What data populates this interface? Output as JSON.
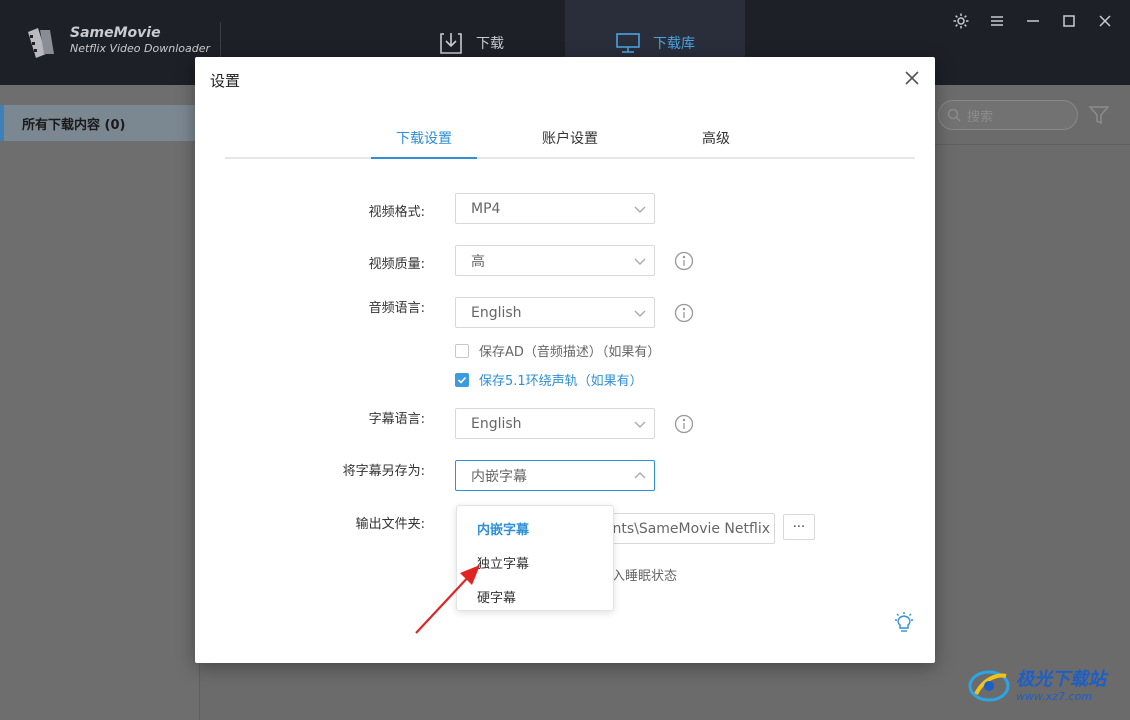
{
  "app": {
    "name": "SameMovie",
    "subtitle": "Netflix Video Downloader",
    "nav": {
      "download": "下载",
      "library": "下载库"
    }
  },
  "sidebar": {
    "all_downloads": "所有下载内容 (0)"
  },
  "search": {
    "placeholder": "搜索"
  },
  "dialog": {
    "title": "设置",
    "tabs": [
      "下载设置",
      "账户设置",
      "高级"
    ],
    "video_format": {
      "label": "视频格式:",
      "value": "MP4"
    },
    "video_quality": {
      "label": "视频质量:",
      "value": "高"
    },
    "audio_language": {
      "label": "音频语言:",
      "value": "English"
    },
    "save_ad": {
      "label": "保存AD（音频描述）（如果有）",
      "checked": false
    },
    "save_51": {
      "label": "保存5.1环绕声轨（如果有）",
      "checked": true
    },
    "subtitle_language": {
      "label": "字幕语言:",
      "value": "English"
    },
    "save_subtitle_as": {
      "label": "将字幕另存为:",
      "value": "内嵌字幕",
      "options": [
        "内嵌字幕",
        "独立字幕",
        "硬字幕"
      ]
    },
    "output_folder": {
      "label": "输出文件夹:",
      "value": "ents\\SameMovie Netflix",
      "more": "···"
    },
    "sleep_text": "进入睡眠状态"
  },
  "watermark": {
    "line1": "极光下载站",
    "line2": "www.xz7.com"
  },
  "colors": {
    "accent": "#2f8fd8",
    "topbar": "#1d2027"
  }
}
